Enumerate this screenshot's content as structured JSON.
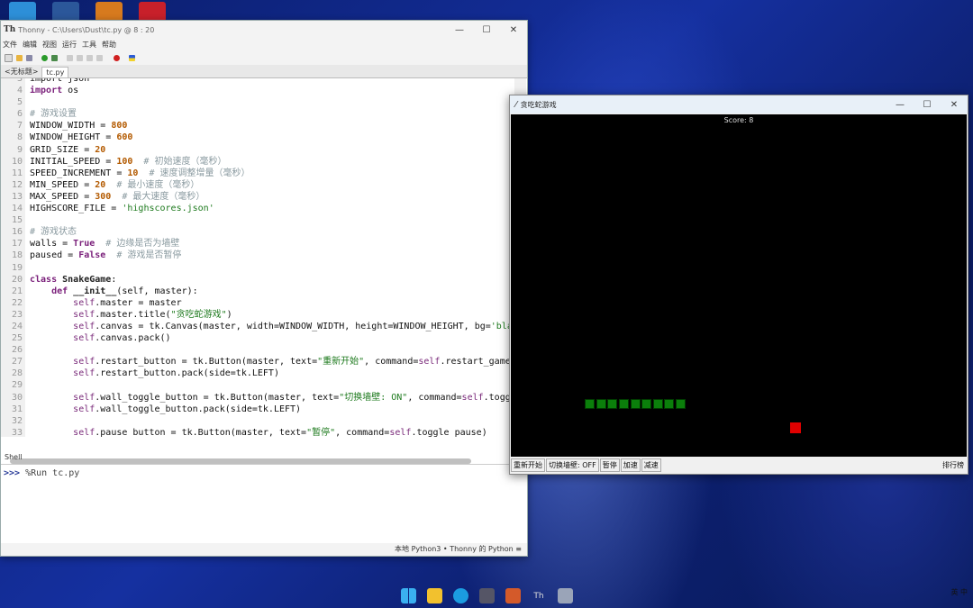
{
  "thonny": {
    "title": "Thonny - C:\\Users\\Dust\\tc.py @ 8 : 20",
    "logo": "Th",
    "menu": [
      "文件",
      "编辑",
      "视图",
      "运行",
      "工具",
      "帮助"
    ],
    "tabs": [
      "<无标题>",
      "tc.py"
    ],
    "code": [
      {
        "n": "3",
        "parts": [
          [
            "",
            "import json"
          ]
        ]
      },
      {
        "n": "4",
        "parts": [
          [
            "k",
            "import"
          ],
          [
            "",
            " os"
          ]
        ]
      },
      {
        "n": "5",
        "parts": []
      },
      {
        "n": "6",
        "parts": [
          [
            "c",
            "# 游戏设置"
          ]
        ]
      },
      {
        "n": "7",
        "parts": [
          [
            "",
            "WINDOW_WIDTH = "
          ],
          [
            "n",
            "800"
          ]
        ]
      },
      {
        "n": "8",
        "parts": [
          [
            "",
            "WINDOW_HEIGHT = "
          ],
          [
            "n",
            "600"
          ]
        ]
      },
      {
        "n": "9",
        "parts": [
          [
            "",
            "GRID_SIZE = "
          ],
          [
            "n",
            "20"
          ]
        ]
      },
      {
        "n": "10",
        "parts": [
          [
            "",
            "INITIAL_SPEED = "
          ],
          [
            "n",
            "100"
          ],
          [
            "c",
            "  # 初始速度（毫秒）"
          ]
        ]
      },
      {
        "n": "11",
        "parts": [
          [
            "",
            "SPEED_INCREMENT = "
          ],
          [
            "n",
            "10"
          ],
          [
            "c",
            "  # 速度调整增量（毫秒）"
          ]
        ]
      },
      {
        "n": "12",
        "parts": [
          [
            "",
            "MIN_SPEED = "
          ],
          [
            "n",
            "20"
          ],
          [
            "c",
            "  # 最小速度（毫秒）"
          ]
        ]
      },
      {
        "n": "13",
        "parts": [
          [
            "",
            "MAX_SPEED = "
          ],
          [
            "n",
            "300"
          ],
          [
            "c",
            "  # 最大速度（毫秒）"
          ]
        ]
      },
      {
        "n": "14",
        "parts": [
          [
            "",
            "HIGHSCORE_FILE = "
          ],
          [
            "s",
            "'highscores.json'"
          ]
        ]
      },
      {
        "n": "15",
        "parts": []
      },
      {
        "n": "16",
        "parts": [
          [
            "c",
            "# 游戏状态"
          ]
        ]
      },
      {
        "n": "17",
        "parts": [
          [
            "",
            "walls = "
          ],
          [
            "k",
            "True"
          ],
          [
            "c",
            "  # 边缘是否为墙壁"
          ]
        ]
      },
      {
        "n": "18",
        "parts": [
          [
            "",
            "paused = "
          ],
          [
            "k",
            "False"
          ],
          [
            "c",
            "  # 游戏是否暂停"
          ]
        ]
      },
      {
        "n": "19",
        "parts": []
      },
      {
        "n": "20",
        "parts": [
          [
            "k",
            "class"
          ],
          [
            "f",
            " SnakeGame"
          ],
          [
            "",
            ":"
          ]
        ]
      },
      {
        "n": "21",
        "parts": [
          [
            "",
            "    "
          ],
          [
            "k",
            "def"
          ],
          [
            "f",
            " __init__"
          ],
          [
            "",
            "(self, master):"
          ]
        ]
      },
      {
        "n": "22",
        "parts": [
          [
            "",
            "        "
          ],
          [
            "sf",
            "self"
          ],
          [
            "",
            ".master = master"
          ]
        ]
      },
      {
        "n": "23",
        "parts": [
          [
            "",
            "        "
          ],
          [
            "sf",
            "self"
          ],
          [
            "",
            ".master.title("
          ],
          [
            "s",
            "\"贪吃蛇游戏\""
          ],
          [
            "",
            ")"
          ]
        ]
      },
      {
        "n": "24",
        "parts": [
          [
            "",
            "        "
          ],
          [
            "sf",
            "self"
          ],
          [
            "",
            ".canvas = tk.Canvas(master, width=WINDOW_WIDTH, height=WINDOW_HEIGHT, bg="
          ],
          [
            "s",
            "'blac"
          ]
        ]
      },
      {
        "n": "25",
        "parts": [
          [
            "",
            "        "
          ],
          [
            "sf",
            "self"
          ],
          [
            "",
            ".canvas.pack()"
          ]
        ]
      },
      {
        "n": "26",
        "parts": []
      },
      {
        "n": "27",
        "parts": [
          [
            "",
            "        "
          ],
          [
            "sf",
            "self"
          ],
          [
            "",
            ".restart_button = tk.Button(master, text="
          ],
          [
            "s",
            "\"重新开始\""
          ],
          [
            "",
            ", command="
          ],
          [
            "sf",
            "self"
          ],
          [
            "",
            ".restart_game)"
          ]
        ]
      },
      {
        "n": "28",
        "parts": [
          [
            "",
            "        "
          ],
          [
            "sf",
            "self"
          ],
          [
            "",
            ".restart_button.pack(side=tk.LEFT)"
          ]
        ]
      },
      {
        "n": "29",
        "parts": []
      },
      {
        "n": "30",
        "parts": [
          [
            "",
            "        "
          ],
          [
            "sf",
            "self"
          ],
          [
            "",
            ".wall_toggle_button = tk.Button(master, text="
          ],
          [
            "s",
            "\"切换墙壁: ON\""
          ],
          [
            "",
            ", command="
          ],
          [
            "sf",
            "self"
          ],
          [
            "",
            ".toggl"
          ]
        ]
      },
      {
        "n": "31",
        "parts": [
          [
            "",
            "        "
          ],
          [
            "sf",
            "self"
          ],
          [
            "",
            ".wall_toggle_button.pack(side=tk.LEFT)"
          ]
        ]
      },
      {
        "n": "32",
        "parts": []
      },
      {
        "n": "33",
        "parts": [
          [
            "",
            "        "
          ],
          [
            "sf",
            "self"
          ],
          [
            "",
            ".pause_button = tk.Button(master, text="
          ],
          [
            "s",
            "\"暂停\""
          ],
          [
            "",
            ", command="
          ],
          [
            "sf",
            "self"
          ],
          [
            "",
            ".toggle_pause)"
          ]
        ]
      }
    ],
    "shell_label": "Shell",
    "shell_prompt": ">>>",
    "shell_command": " %Run tc.py",
    "status": "本地 Python3 • Thonny 的 Python ≡"
  },
  "game": {
    "title": "贪吃蛇游戏",
    "score": "Score: 8",
    "buttons": [
      "重新开始",
      "切换墙壁: OFF",
      "暂停",
      "加速",
      "减速"
    ],
    "leaderboard": "排行榜"
  },
  "taskbar": {
    "tray": "英 中"
  },
  "colors": {
    "snake": "#0b7f0b",
    "food": "#e00000",
    "canvas": "#000000"
  },
  "snake_cells": [
    [
      6,
      25
    ],
    [
      7,
      25
    ],
    [
      8,
      25
    ],
    [
      9,
      25
    ],
    [
      10,
      25
    ],
    [
      11,
      25
    ],
    [
      12,
      25
    ],
    [
      13,
      25
    ],
    [
      14,
      25
    ]
  ],
  "food_cell": [
    25,
    28
  ]
}
